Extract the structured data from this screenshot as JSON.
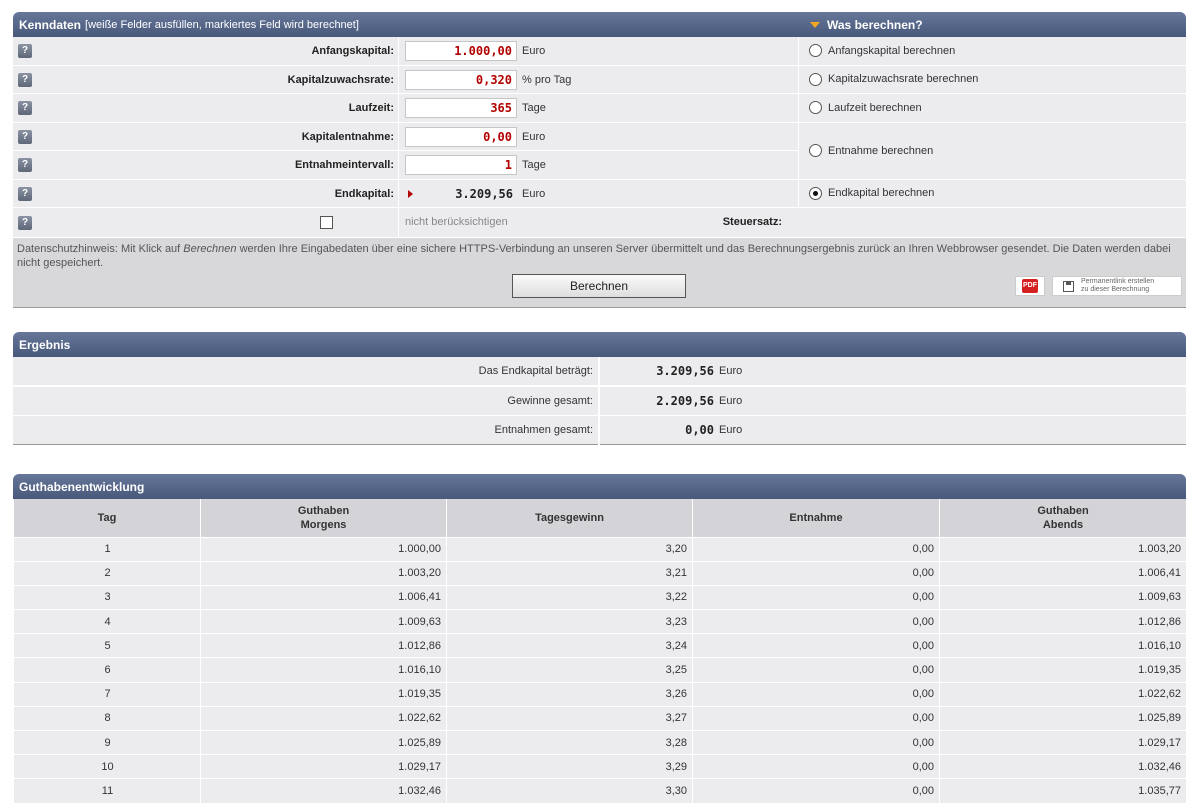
{
  "kenndaten": {
    "title": "Kenndaten",
    "subtitle": "[weiße Felder ausfüllen, markiertes Feld wird berechnet]",
    "right_title": "Was berechnen?",
    "help_label": "?",
    "fields": [
      {
        "label": "Anfangskapital:",
        "value": "1.000,00",
        "unit": "Euro"
      },
      {
        "label": "Kapitalzuwachsrate:",
        "value": "0,320",
        "unit": "% pro Tag"
      },
      {
        "label": "Laufzeit:",
        "value": "365",
        "unit": "Tage"
      },
      {
        "label": "Kapitalentnahme:",
        "value": "0,00",
        "unit": "Euro"
      },
      {
        "label": "Entnahmeintervall:",
        "value": "1",
        "unit": "Tage"
      },
      {
        "label": "Endkapital:",
        "value": "3.209,56",
        "unit": "Euro"
      }
    ],
    "steuersatz": {
      "label": "Steuersatz:",
      "note": "nicht berücksichtigen"
    },
    "options": [
      {
        "label": "Anfangskapital berechnen",
        "selected": false
      },
      {
        "label": "Kapitalzuwachsrate berechnen",
        "selected": false
      },
      {
        "label": "Laufzeit berechnen",
        "selected": false
      },
      {
        "label": "Entnahme berechnen",
        "selected": false
      },
      {
        "label": "Endkapital berechnen",
        "selected": true
      }
    ],
    "notice": {
      "part1": "Datenschutzhinweis: Mit Klick auf ",
      "em": "Berechnen",
      "part2": " werden Ihre Eingabedaten über eine sichere HTTPS-Verbindung an unseren Server übermittelt und das Berechnungsergebnis zurück an Ihren Webbrowser gesendet. Die Daten werden dabei nicht gespeichert."
    },
    "calc_button": "Berechnen",
    "pdf_label": "PDF",
    "permalink_line1": "Permanentlink erstellen",
    "permalink_line2": "zu dieser Berechnung"
  },
  "ergebnis": {
    "title": "Ergebnis",
    "rows": [
      {
        "label": "Das Endkapital beträgt:",
        "value": "3.209,56",
        "unit": "Euro"
      },
      {
        "label": "Gewinne gesamt:",
        "value": "2.209,56",
        "unit": "Euro"
      },
      {
        "label": "Entnahmen gesamt:",
        "value": "0,00",
        "unit": "Euro"
      }
    ]
  },
  "guthaben": {
    "title": "Guthabenentwicklung",
    "headers": [
      {
        "line1": "Tag",
        "line2": ""
      },
      {
        "line1": "Guthaben",
        "line2": "Morgens"
      },
      {
        "line1": "Tagesgewinn",
        "line2": ""
      },
      {
        "line1": "Entnahme",
        "line2": ""
      },
      {
        "line1": "Guthaben",
        "line2": "Abends"
      }
    ],
    "rows": [
      [
        "1",
        "1.000,00",
        "3,20",
        "0,00",
        "1.003,20"
      ],
      [
        "2",
        "1.003,20",
        "3,21",
        "0,00",
        "1.006,41"
      ],
      [
        "3",
        "1.006,41",
        "3,22",
        "0,00",
        "1.009,63"
      ],
      [
        "4",
        "1.009,63",
        "3,23",
        "0,00",
        "1.012,86"
      ],
      [
        "5",
        "1.012,86",
        "3,24",
        "0,00",
        "1.016,10"
      ],
      [
        "6",
        "1.016,10",
        "3,25",
        "0,00",
        "1.019,35"
      ],
      [
        "7",
        "1.019,35",
        "3,26",
        "0,00",
        "1.022,62"
      ],
      [
        "8",
        "1.022,62",
        "3,27",
        "0,00",
        "1.025,89"
      ],
      [
        "9",
        "1.025,89",
        "3,28",
        "0,00",
        "1.029,17"
      ],
      [
        "10",
        "1.029,17",
        "3,29",
        "0,00",
        "1.032,46"
      ],
      [
        "11",
        "1.032,46",
        "3,30",
        "0,00",
        "1.035,77"
      ]
    ]
  }
}
